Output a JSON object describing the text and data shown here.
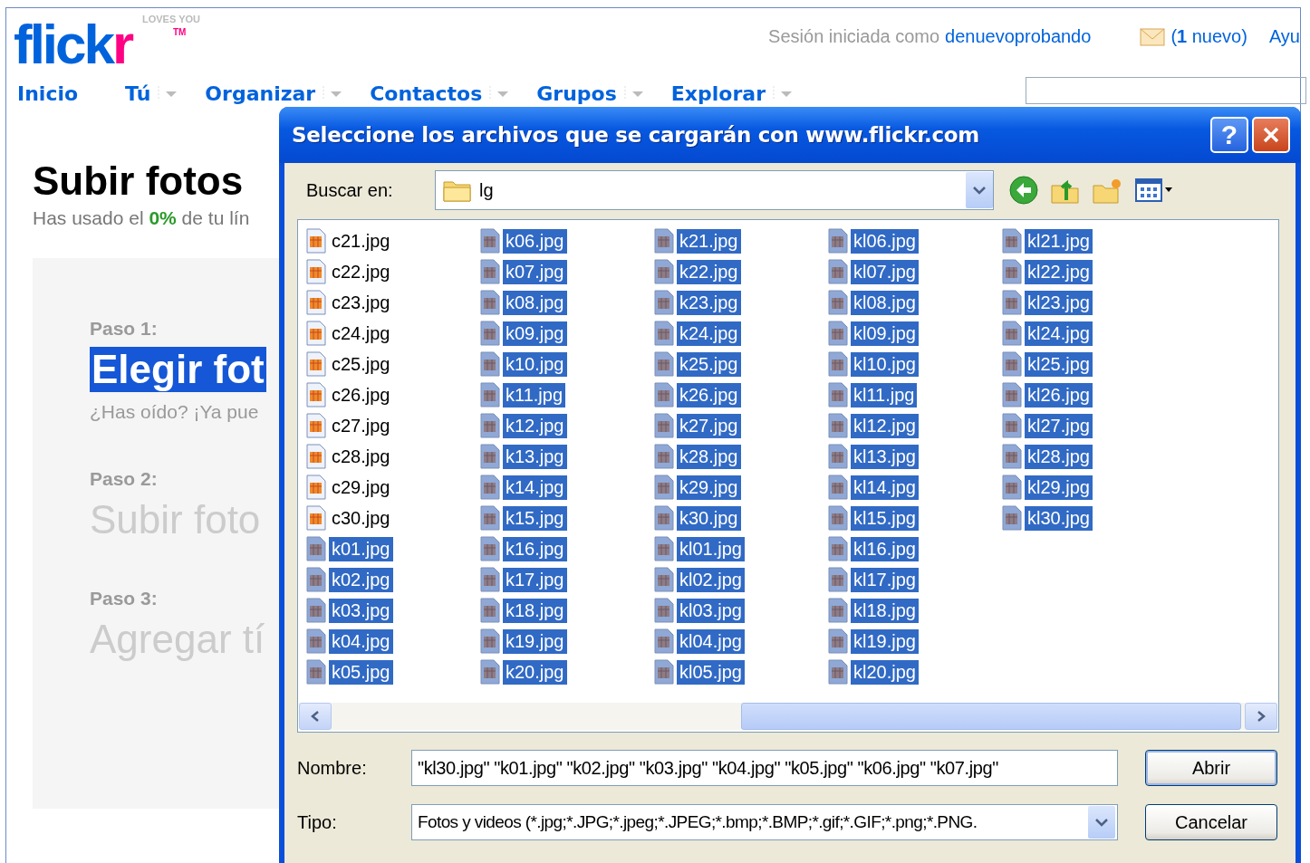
{
  "logo": {
    "main": "flick",
    "accent": "r",
    "tagline": "LOVES YOU",
    "mark": "TM"
  },
  "session": {
    "prefix": "Sesión iniciada como",
    "user": "denuevoprobando",
    "mail": "(**1** nuevo)",
    "help": "Ayu"
  },
  "nav": [
    {
      "label": "Inicio",
      "has_menu": false
    },
    {
      "label": "Tú",
      "has_menu": true
    },
    {
      "label": "Organizar",
      "has_menu": true
    },
    {
      "label": "Contactos",
      "has_menu": true
    },
    {
      "label": "Grupos",
      "has_menu": true
    },
    {
      "label": "Explorar",
      "has_menu": true
    }
  ],
  "page": {
    "title": "Subir fotos",
    "usage": "Has usado el **0%** de tu lín",
    "steps": [
      {
        "label": "Paso 1:",
        "title": "Elegir fot",
        "note": "¿Has oído? ¡Ya pue",
        "highlighted": true
      },
      {
        "label": "Paso 2:",
        "title": "Subir foto",
        "highlighted": false
      },
      {
        "label": "Paso 3:",
        "title": "Agregar tí",
        "highlighted": false
      }
    ]
  },
  "dialog": {
    "title": "Seleccione los archivos que se cargarán con www.flickr.com",
    "help_button": "?",
    "look_in": {
      "label": "Buscar en:",
      "value": "lg"
    },
    "files": [
      {
        "name": "c21.jpg",
        "selected": false
      },
      {
        "name": "c22.jpg",
        "selected": false
      },
      {
        "name": "c23.jpg",
        "selected": false
      },
      {
        "name": "c24.jpg",
        "selected": false
      },
      {
        "name": "c25.jpg",
        "selected": false
      },
      {
        "name": "c26.jpg",
        "selected": false
      },
      {
        "name": "c27.jpg",
        "selected": false
      },
      {
        "name": "c28.jpg",
        "selected": false
      },
      {
        "name": "c29.jpg",
        "selected": false
      },
      {
        "name": "c30.jpg",
        "selected": false
      },
      {
        "name": "k01.jpg",
        "selected": true
      },
      {
        "name": "k02.jpg",
        "selected": true
      },
      {
        "name": "k03.jpg",
        "selected": true
      },
      {
        "name": "k04.jpg",
        "selected": true
      },
      {
        "name": "k05.jpg",
        "selected": true
      },
      {
        "name": "k06.jpg",
        "selected": true
      },
      {
        "name": "k07.jpg",
        "selected": true
      },
      {
        "name": "k08.jpg",
        "selected": true
      },
      {
        "name": "k09.jpg",
        "selected": true
      },
      {
        "name": "k10.jpg",
        "selected": true
      },
      {
        "name": "k11.jpg",
        "selected": true
      },
      {
        "name": "k12.jpg",
        "selected": true
      },
      {
        "name": "k13.jpg",
        "selected": true
      },
      {
        "name": "k14.jpg",
        "selected": true
      },
      {
        "name": "k15.jpg",
        "selected": true
      },
      {
        "name": "k16.jpg",
        "selected": true
      },
      {
        "name": "k17.jpg",
        "selected": true
      },
      {
        "name": "k18.jpg",
        "selected": true
      },
      {
        "name": "k19.jpg",
        "selected": true
      },
      {
        "name": "k20.jpg",
        "selected": true
      },
      {
        "name": "k21.jpg",
        "selected": true
      },
      {
        "name": "k22.jpg",
        "selected": true
      },
      {
        "name": "k23.jpg",
        "selected": true
      },
      {
        "name": "k24.jpg",
        "selected": true
      },
      {
        "name": "k25.jpg",
        "selected": true
      },
      {
        "name": "k26.jpg",
        "selected": true
      },
      {
        "name": "k27.jpg",
        "selected": true
      },
      {
        "name": "k28.jpg",
        "selected": true
      },
      {
        "name": "k29.jpg",
        "selected": true
      },
      {
        "name": "k30.jpg",
        "selected": true
      },
      {
        "name": "kl01.jpg",
        "selected": true
      },
      {
        "name": "kl02.jpg",
        "selected": true
      },
      {
        "name": "kl03.jpg",
        "selected": true
      },
      {
        "name": "kl04.jpg",
        "selected": true
      },
      {
        "name": "kl05.jpg",
        "selected": true
      },
      {
        "name": "kl06.jpg",
        "selected": true
      },
      {
        "name": "kl07.jpg",
        "selected": true
      },
      {
        "name": "kl08.jpg",
        "selected": true
      },
      {
        "name": "kl09.jpg",
        "selected": true
      },
      {
        "name": "kl10.jpg",
        "selected": true
      },
      {
        "name": "kl11.jpg",
        "selected": true
      },
      {
        "name": "kl12.jpg",
        "selected": true
      },
      {
        "name": "kl13.jpg",
        "selected": true
      },
      {
        "name": "kl14.jpg",
        "selected": true
      },
      {
        "name": "kl15.jpg",
        "selected": true
      },
      {
        "name": "kl16.jpg",
        "selected": true
      },
      {
        "name": "kl17.jpg",
        "selected": true
      },
      {
        "name": "kl18.jpg",
        "selected": true
      },
      {
        "name": "kl19.jpg",
        "selected": true
      },
      {
        "name": "kl20.jpg",
        "selected": true
      },
      {
        "name": "kl21.jpg",
        "selected": true
      },
      {
        "name": "kl22.jpg",
        "selected": true
      },
      {
        "name": "kl23.jpg",
        "selected": true
      },
      {
        "name": "kl24.jpg",
        "selected": true
      },
      {
        "name": "kl25.jpg",
        "selected": true
      },
      {
        "name": "kl26.jpg",
        "selected": true
      },
      {
        "name": "kl27.jpg",
        "selected": true
      },
      {
        "name": "kl28.jpg",
        "selected": true
      },
      {
        "name": "kl29.jpg",
        "selected": true
      },
      {
        "name": "kl30.jpg",
        "selected": true
      }
    ],
    "filename": {
      "label": "Nombre:",
      "value": "\"kl30.jpg\" \"k01.jpg\" \"k02.jpg\" \"k03.jpg\" \"k04.jpg\" \"k05.jpg\" \"k06.jpg\" \"k07.jpg\""
    },
    "filetype": {
      "label": "Tipo:",
      "value": "Fotos y videos (*.jpg;*.JPG;*.jpeg;*.JPEG;*.bmp;*.BMP;*.gif;*.GIF;*.png;*.PNG."
    },
    "buttons": [
      "Abrir",
      "Cancelar"
    ]
  }
}
